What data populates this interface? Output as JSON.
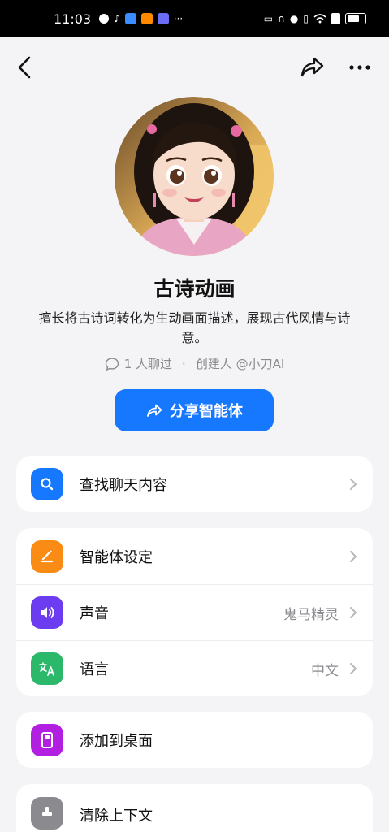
{
  "status_bar": {
    "time": "11:03",
    "left_icons": [
      "wechat-icon",
      "tiktok-icon",
      "app-icon",
      "weibo-icon",
      "music-icon",
      "more-dots-icon"
    ],
    "right_icons": [
      "cast-icon",
      "headphones-icon",
      "mic-icon",
      "vibrate-icon",
      "wifi-icon",
      "alert-icon",
      "battery-icon"
    ]
  },
  "nav": {
    "back_icon": "chevron-left-icon",
    "share_icon": "share-icon",
    "more_icon": "more-icon"
  },
  "profile": {
    "name": "古诗动画",
    "description": "擅长将古诗词转化为生动画面描述，展现古代风情与诗意。",
    "chat_count": "1 人聊过",
    "separator": "·",
    "creator": "创建人 @小刀AI"
  },
  "share_button": {
    "label": "分享智能体"
  },
  "cards": {
    "search": {
      "label": "查找聊天内容"
    },
    "settings": {
      "label": "智能体设定",
      "voice_label": "声音",
      "voice_value": "鬼马精灵",
      "language_label": "语言",
      "language_value": "中文"
    },
    "desktop": {
      "label": "添加到桌面"
    },
    "clear": {
      "label": "清除上下文"
    }
  },
  "colors": {
    "accent": "#1677ff",
    "search_icon_bg": "#1677ff",
    "settings_icon_bg": "#fa8c16",
    "voice_icon_bg": "#6b3cf0",
    "language_icon_bg": "#2bb86a",
    "desktop_icon_bg": "#b21fe0",
    "clear_icon_bg": "#8a8a8f"
  }
}
